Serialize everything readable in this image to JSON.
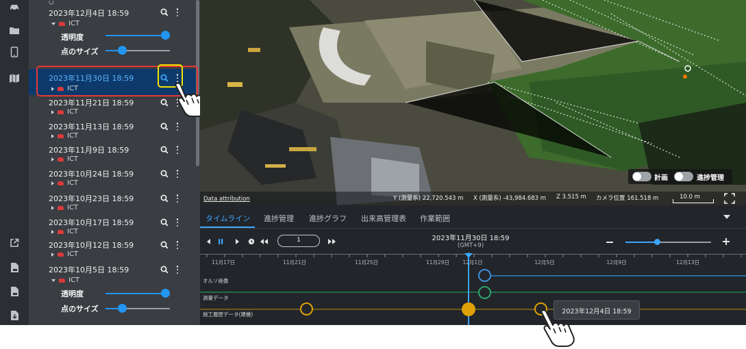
{
  "sidebar_rail": {
    "icons": [
      "car-icon",
      "folder-icon",
      "tablet-icon",
      "map-icon",
      "external-link-icon",
      "csv-file-icon",
      "pdf-file-icon",
      "download-icon"
    ]
  },
  "layers": {
    "entries": [
      {
        "date": "2023年12月4日 18:59",
        "sub": "ICT",
        "expanded": true,
        "opacity_label": "透明度",
        "point_size_label": "点のサイズ",
        "opacity": 0.9,
        "point_size": 0.2
      },
      {
        "date": "2023年11月30日 18:59",
        "sub": "ICT",
        "selected": true
      },
      {
        "date": "2023年11月21日 18:59",
        "sub": "ICT"
      },
      {
        "date": "2023年11月13日 18:59",
        "sub": "ICT"
      },
      {
        "date": "2023年11月9日 18:59",
        "sub": "ICT"
      },
      {
        "date": "2023年10月24日 18:59",
        "sub": "ICT"
      },
      {
        "date": "2023年10月23日 18:59",
        "sub": "ICT"
      },
      {
        "date": "2023年10月17日 18:59",
        "sub": "ICT"
      },
      {
        "date": "2023年10月12日 18:59",
        "sub": "ICT"
      },
      {
        "date": "2023年10月5日 18:59",
        "sub": "ICT",
        "expanded": true,
        "opacity_label": "透明度",
        "point_size_label": "点のサイズ",
        "opacity": 0.9,
        "point_size": 0.2
      }
    ]
  },
  "map": {
    "toggles": {
      "plan": "計画",
      "progress": "進捗管理"
    },
    "attribution": "Data attribution",
    "coord_y": "Y (測量系) 22,720.543 m",
    "coord_x": "X (測量系) -43,984.683 m",
    "coord_z": "Z 3.515 m",
    "camera": "カメラ位置 161.518 m",
    "scale": "10.0 m"
  },
  "timeline": {
    "tabs": [
      "タイムライン",
      "進捗管理",
      "進捗グラフ",
      "出来高管理表",
      "作業範囲"
    ],
    "active_tab": 0,
    "current_date": "2023年11月30日 18:59",
    "timezone": "(GMT+9)",
    "speed": "1",
    "zoom_level": 0.35,
    "ticks": [
      "11月17日",
      "11月21日",
      "11月25日",
      "11月29日",
      "12月1日",
      "12月5日",
      "12月9日",
      "12月13日"
    ],
    "rows": [
      "オルソ画像",
      "測量データ",
      "施工履歴データ(建機)"
    ],
    "tooltip": "2023年12月4日 18:59"
  },
  "colors": {
    "accent": "#3ea6ff",
    "highlight_red": "#e53935",
    "highlight_yellow": "#f5e400",
    "ortho_blue": "#3f8fd8",
    "survey_green": "#2fa36b",
    "machine_orange": "#e0a106"
  }
}
